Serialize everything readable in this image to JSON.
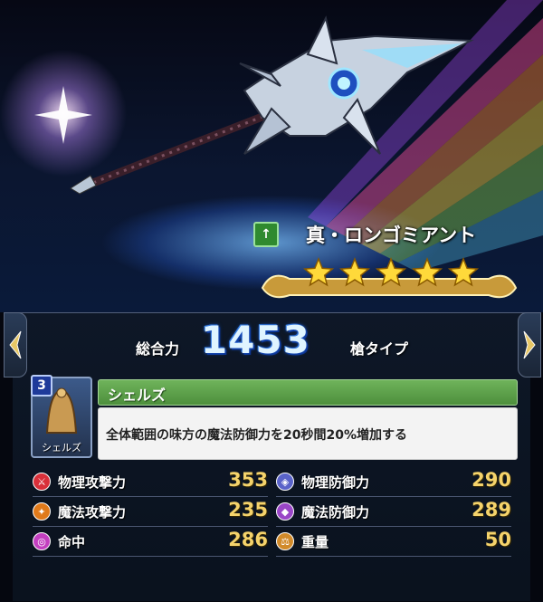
{
  "weapon": {
    "name": "真・ロンゴミアント",
    "type_icon": "spear-type-icon",
    "rarity_stars": 5
  },
  "summary": {
    "total_label": "総合力",
    "total_value": "1453",
    "weapon_type": "槍タイプ"
  },
  "ability": {
    "rank": "3",
    "icon_caption": "シェルズ",
    "name": "シェルズ",
    "description": "全体範囲の味方の魔法防御力を20秒間20%増加する"
  },
  "stats": [
    {
      "icon": "sword-icon",
      "label": "物理攻撃力",
      "value": "353",
      "color": "#d9303a"
    },
    {
      "icon": "shield-icon",
      "label": "物理防御力",
      "value": "290",
      "color": "#5a63c9"
    },
    {
      "icon": "magic-wand-icon",
      "label": "魔法攻撃力",
      "value": "235",
      "color": "#e07a1a"
    },
    {
      "icon": "magic-shield-icon",
      "label": "魔法防御力",
      "value": "289",
      "color": "#9a46c7"
    },
    {
      "icon": "target-icon",
      "label": "命中",
      "value": "286",
      "color": "#c33fbf"
    },
    {
      "icon": "weight-icon",
      "label": "重量",
      "value": "50",
      "color": "#d18a2a"
    }
  ],
  "colors": {
    "ability_bar": "#5fa34b",
    "stat_value": "#f5d36b",
    "total_glow": "#1b56c9"
  }
}
